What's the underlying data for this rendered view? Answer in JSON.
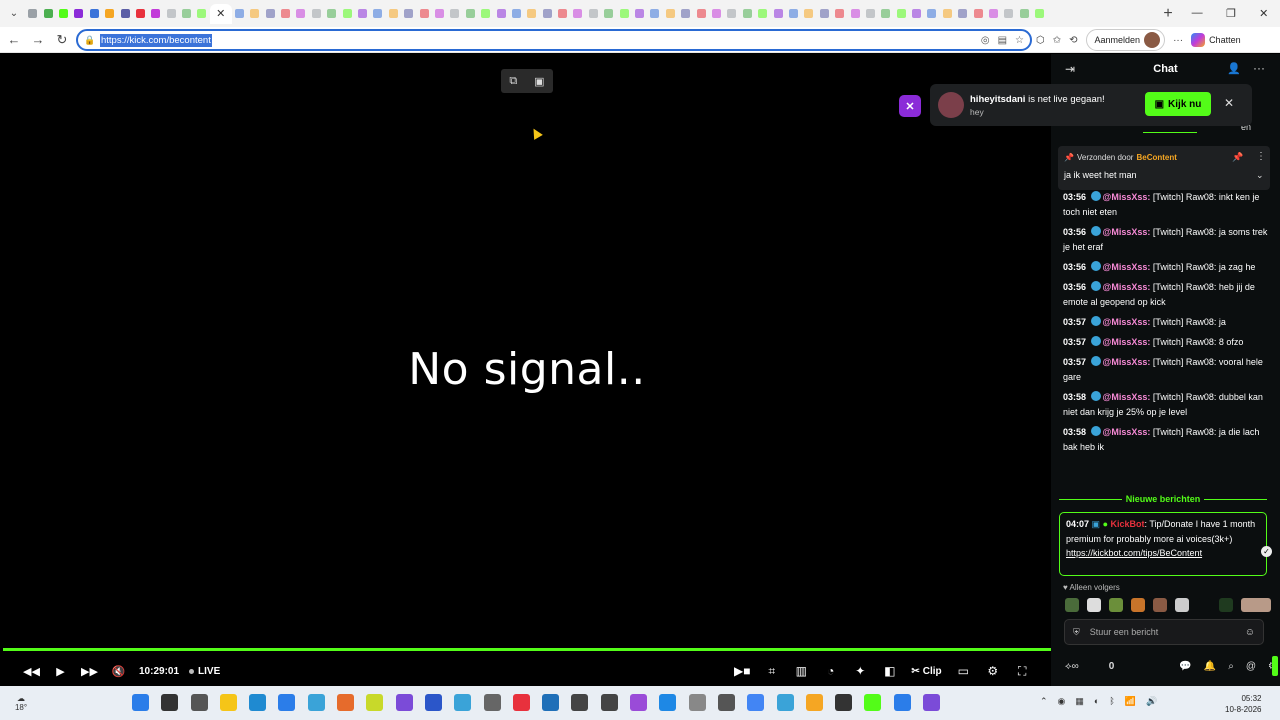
{
  "browser": {
    "tab_count": 66,
    "tab_close": "✕",
    "new_tab": "+",
    "window_controls": [
      "—",
      "❐",
      "✕"
    ],
    "url": "https://kick.com/becontent",
    "signin_label": "Aanmelden",
    "chat_label": "Chatten"
  },
  "player": {
    "status_text": "No signal..",
    "time": "10:29:01",
    "live_label": "LIVE",
    "clip_label": "Clip",
    "progress_percent": 100
  },
  "notification": {
    "streamer": "hiheyitsdani",
    "text": " is net live gegaan!",
    "subtitle": "hey",
    "watch_label": "Kijk nu"
  },
  "chat": {
    "title": "Chat",
    "lang_tag": "en",
    "pinned": {
      "prefix": "Verzonden door",
      "sender": "BeContent",
      "message": "ja ik weet het man"
    },
    "messages": [
      {
        "time": "03:56",
        "user": "@MissXss:",
        "text": " [Twitch] Raw08: inkt ken je toch niet eten"
      },
      {
        "time": "03:56",
        "user": "@MissXss:",
        "text": " [Twitch] Raw08: ja soms trek je het eraf"
      },
      {
        "time": "03:56",
        "user": "@MissXss:",
        "text": " [Twitch] Raw08: ja zag he"
      },
      {
        "time": "03:56",
        "user": "@MissXss:",
        "text": " [Twitch] Raw08: heb jij de emote al geopend op kick"
      },
      {
        "time": "03:57",
        "user": "@MissXss:",
        "text": " [Twitch] Raw08: ja"
      },
      {
        "time": "03:57",
        "user": "@MissXss:",
        "text": " [Twitch] Raw08: 8 ofzo"
      },
      {
        "time": "03:57",
        "user": "@MissXss:",
        "text": " [Twitch] Raw08: vooral hele gare"
      },
      {
        "time": "03:58",
        "user": "@MissXss:",
        "text": " [Twitch] Raw08: dubbel kan niet dan krijg je 25% op je level"
      },
      {
        "time": "03:58",
        "user": "@MissXss:",
        "text": " [Twitch] Raw08: ja die lach bak heb ik"
      }
    ],
    "new_messages_label": "Nieuwe berichten",
    "highlight": {
      "time": "04:07",
      "user": "KickBot",
      "text": ": Tip/Donate I have 1 month premium for probably more ai voices(3k+)",
      "link": "https://kickbot.com/tips/BeContent"
    },
    "followers_only": "Alleen volgers",
    "input_placeholder": "Stuur een bericht",
    "footer_count": "0"
  },
  "taskbar": {
    "weather": "18°",
    "time": "05:32",
    "date": "10-8-2026"
  },
  "colors": {
    "kick_green": "#53fc18",
    "username_pink": "#f78ad6",
    "kickbot_red": "#e8313d",
    "pinned_sender": "#f5a623"
  }
}
